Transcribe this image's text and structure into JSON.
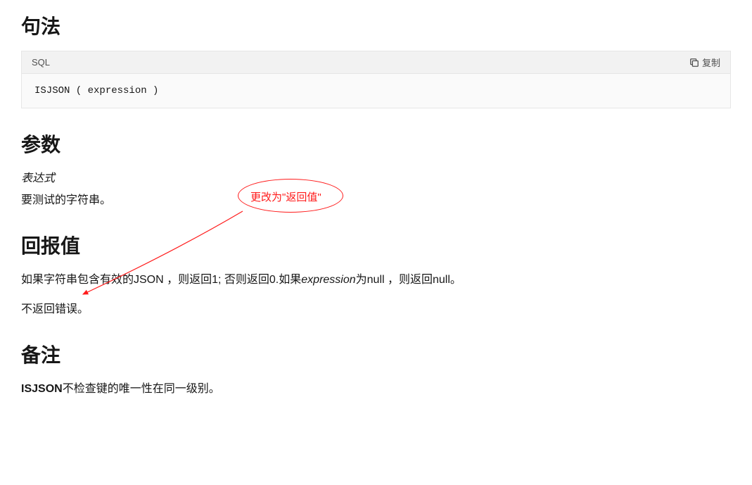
{
  "headings": {
    "syntax": "句法",
    "arguments": "参数",
    "return_value": "回报值",
    "remarks": "备注"
  },
  "code_block": {
    "lang": "SQL",
    "copy_label": "复制",
    "code": "ISJSON ( expression )"
  },
  "arguments": {
    "name": "表达式",
    "desc": "要测试的字符串。"
  },
  "return_value": {
    "p1_a": "如果字符串包含有效的JSON ，则返回1; 否则返回0.如果",
    "p1_italic": "expression",
    "p1_b": "为null  ，则返回null。",
    "p2": "不返回错误。"
  },
  "remarks": {
    "p1_bold": "ISJSON",
    "p1_rest": "不检查键的唯一性在同一级别。"
  },
  "annotation": {
    "text": "更改为\"返回值\""
  }
}
